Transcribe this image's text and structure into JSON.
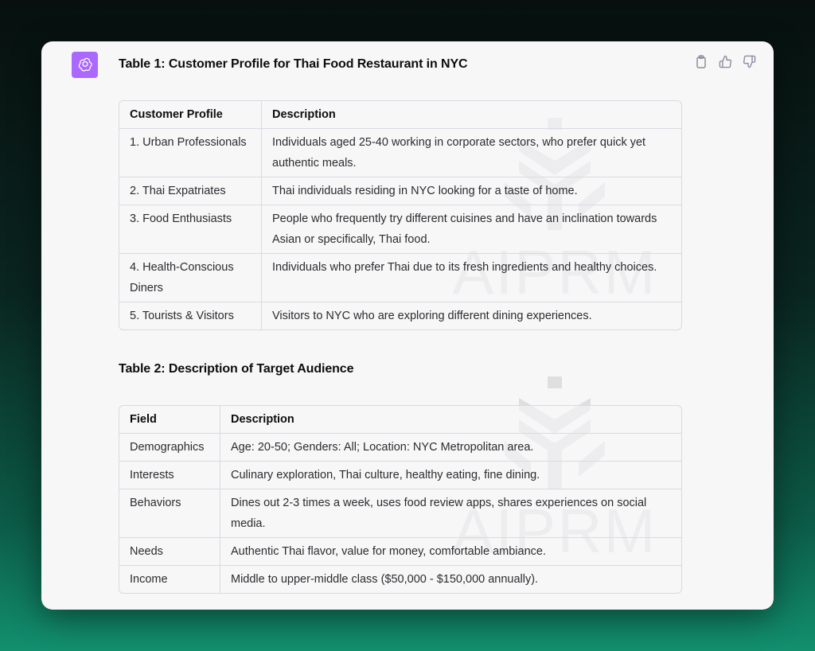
{
  "message": {
    "table1_title": "Table 1: Customer Profile for Thai Food Restaurant in NYC",
    "table1": {
      "headers": [
        "Customer Profile",
        "Description"
      ],
      "rows": [
        [
          "1. Urban Professionals",
          "Individuals aged 25-40 working in corporate sectors, who prefer quick yet authentic meals."
        ],
        [
          "2. Thai Expatriates",
          "Thai individuals residing in NYC looking for a taste of home."
        ],
        [
          "3. Food Enthusiasts",
          "People who frequently try different cuisines and have an inclination towards Asian or specifically, Thai food."
        ],
        [
          "4. Health-Conscious Diners",
          "Individuals who prefer Thai due to its fresh ingredients and healthy choices."
        ],
        [
          "5. Tourists & Visitors",
          "Visitors to NYC who are exploring different dining experiences."
        ]
      ]
    },
    "table2_title": "Table 2: Description of Target Audience",
    "table2": {
      "headers": [
        "Field",
        "Description"
      ],
      "rows": [
        [
          "Demographics",
          "Age: 20-50; Genders: All; Location: NYC Metropolitan area."
        ],
        [
          "Interests",
          "Culinary exploration, Thai culture, healthy eating, fine dining."
        ],
        [
          "Behaviors",
          "Dines out 2-3 times a week, uses food review apps, shares experiences on social media."
        ],
        [
          "Needs",
          "Authentic Thai flavor, value for money, comfortable ambiance."
        ],
        [
          "Income",
          "Middle to upper-middle class ($50,000 - $150,000 annually)."
        ]
      ]
    }
  },
  "watermark": {
    "text": "AIPRM"
  },
  "icons": {
    "avatar": "openai-logo-icon",
    "copy": "clipboard-icon",
    "like": "thumbs-up-icon",
    "dislike": "thumbs-down-icon"
  },
  "colors": {
    "avatar_bg": "#ab68ff",
    "card_bg": "#f7f7f8",
    "border": "#d9d9e3"
  }
}
